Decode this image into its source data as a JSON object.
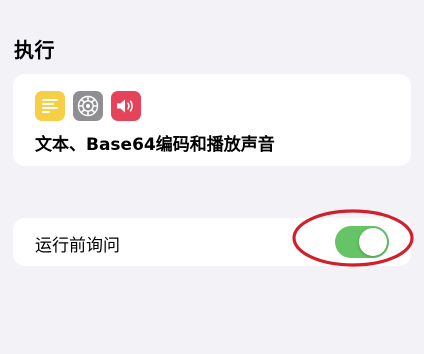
{
  "section": {
    "title": "执行"
  },
  "action_card": {
    "icons": [
      "text-icon",
      "gear-icon",
      "speaker-icon"
    ],
    "summary": "文本、Base64编码和播放声音"
  },
  "ask_card": {
    "label": "运行前询问",
    "toggle_on": true
  },
  "colors": {
    "background": "#f2f2f7",
    "card": "#ffffff",
    "toggle_on": "#65c466",
    "text_icon": "#f7cf46",
    "settings_icon": "#8e8e93",
    "sound_icon": "#e5435a",
    "annotation": "#d0202b"
  }
}
